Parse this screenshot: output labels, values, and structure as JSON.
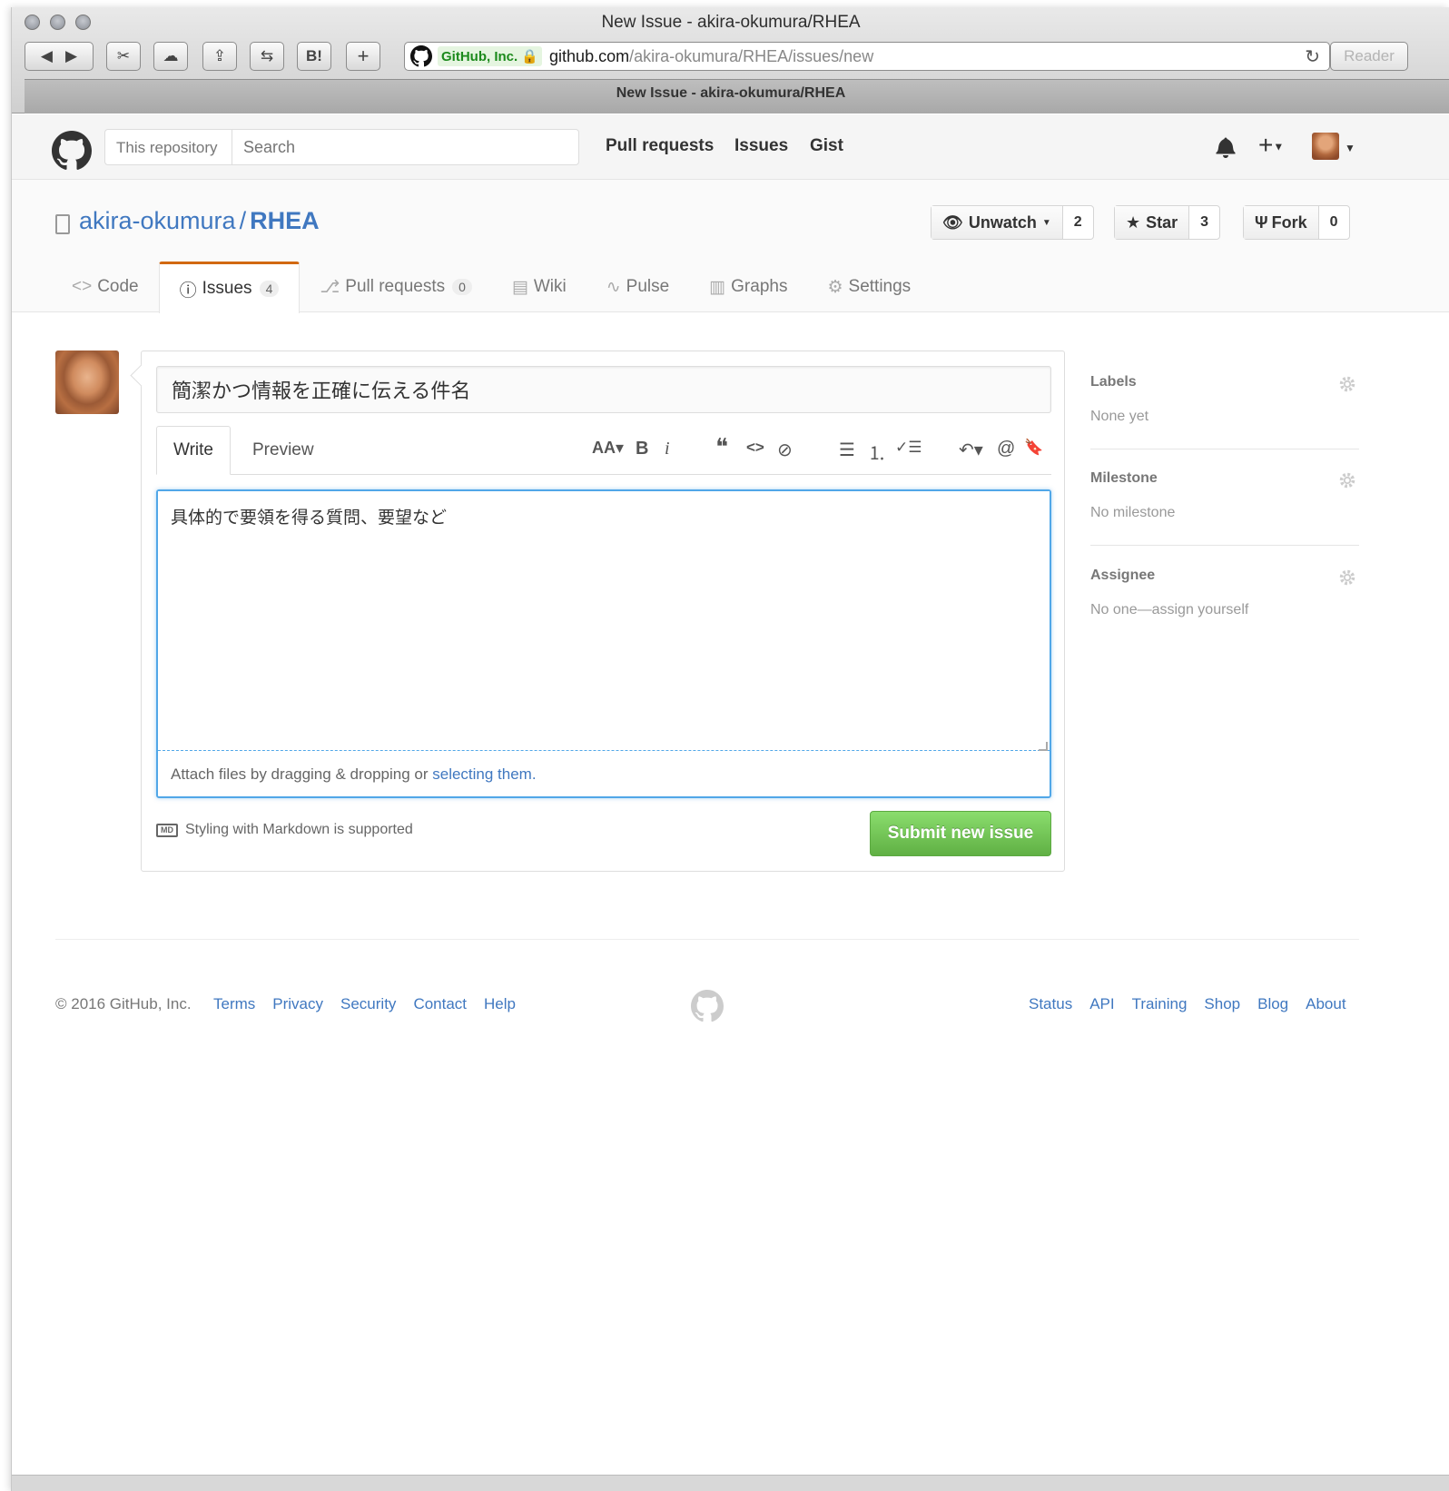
{
  "browser": {
    "window_title": "New Issue - akira-okumura/RHEA",
    "tab_title": "New Issue - akira-okumura/RHEA",
    "cert_label": "GitHub, Inc.",
    "url_host": "github.com",
    "url_path": "/akira-okumura/RHEA/issues/new",
    "reader_label": "Reader",
    "toolbar": [
      "◀",
      "▶",
      "✂",
      "☁",
      "⇪",
      "⇆",
      "B!",
      "+"
    ]
  },
  "header": {
    "scope_label": "This repository",
    "search_placeholder": "Search",
    "nav": [
      "Pull requests",
      "Issues",
      "Gist"
    ],
    "plus_label": "+"
  },
  "repo": {
    "owner": "akira-okumura",
    "separator": "/",
    "name": "RHEA",
    "unwatch_label": "Unwatch",
    "unwatch_count": "2",
    "star_label": "Star",
    "star_count": "3",
    "fork_label": "Fork",
    "fork_count": "0",
    "tabs": [
      {
        "label": "Code",
        "icon": "<>"
      },
      {
        "label": "Issues",
        "icon": "ⓘ",
        "count": "4"
      },
      {
        "label": "Pull requests",
        "icon": "⎇",
        "count": "0"
      },
      {
        "label": "Wiki",
        "icon": "▤"
      },
      {
        "label": "Pulse",
        "icon": "∿"
      },
      {
        "label": "Graphs",
        "icon": "▥"
      },
      {
        "label": "Settings",
        "icon": "⚙"
      }
    ]
  },
  "issue": {
    "title_value": "簡潔かつ情報を正確に伝える件名",
    "write_tab": "Write",
    "preview_tab": "Preview",
    "toolbar": [
      "AA▾",
      "B",
      "i",
      "❝",
      "<>",
      "⊘",
      "☰",
      "⒈",
      "✓☰",
      "↶▾",
      "@",
      "🔖"
    ],
    "body_value": "具体的で要領を得る質問、要望など",
    "attach_prefix": "Attach files by dragging & dropping or ",
    "attach_link": "selecting them.",
    "markdown_note": "Styling with Markdown is supported",
    "markdown_icon_text": "MD",
    "submit_label": "Submit new issue"
  },
  "sidebar": {
    "labels_title": "Labels",
    "labels_value": "None yet",
    "milestone_title": "Milestone",
    "milestone_value": "No milestone",
    "assignee_title": "Assignee",
    "assignee_value": "No one—assign yourself"
  },
  "footer": {
    "copyright": "© 2016 GitHub, Inc.",
    "left_links": [
      "Terms",
      "Privacy",
      "Security",
      "Contact",
      "Help"
    ],
    "right_links": [
      "Status",
      "API",
      "Training",
      "Shop",
      "Blog",
      "About"
    ]
  },
  "colors": {
    "link": "#4078c0",
    "submit_green": "#60b044",
    "selected_tab_accent": "#d26911",
    "focus_blue": "#51a7e8"
  }
}
